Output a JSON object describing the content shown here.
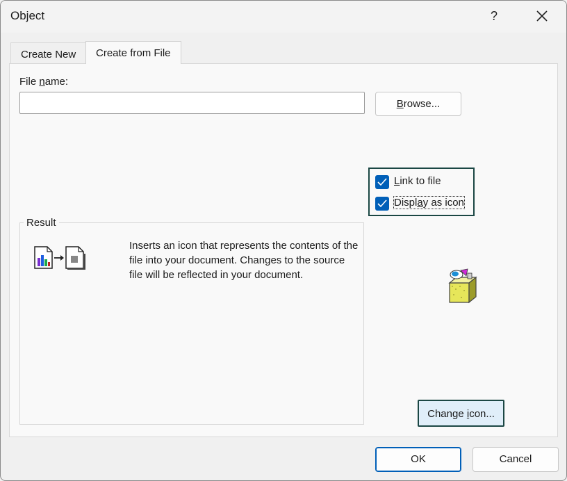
{
  "window": {
    "title": "Object",
    "help_label": "?",
    "close_icon": "close-icon"
  },
  "tabs": [
    {
      "label": "Create New",
      "active": false
    },
    {
      "label": "Create from File",
      "active": true
    }
  ],
  "file": {
    "label_pre": "File ",
    "label_ul": "n",
    "label_post": "ame:",
    "value": "",
    "browse_pre": "",
    "browse_ul": "B",
    "browse_post": "rowse..."
  },
  "options": {
    "link": {
      "pre": "",
      "ul": "L",
      "post": "ink to file",
      "checked": true
    },
    "display": {
      "pre": "Displ",
      "ul": "a",
      "post": "y as icon",
      "checked": true
    }
  },
  "result": {
    "label": "Result",
    "description": "Inserts an icon that represents the contents of the file into your document. Changes to the source file will be reflected in your document."
  },
  "buttons": {
    "change_icon_pre": "Change ",
    "change_icon_ul": "i",
    "change_icon_post": "con...",
    "ok": "OK",
    "cancel": "Cancel"
  },
  "colors": {
    "accent": "#005fb8",
    "focus_border": "#1b4744",
    "panel_bg": "#f9f9f9",
    "window_bg": "#f0f0f0"
  }
}
